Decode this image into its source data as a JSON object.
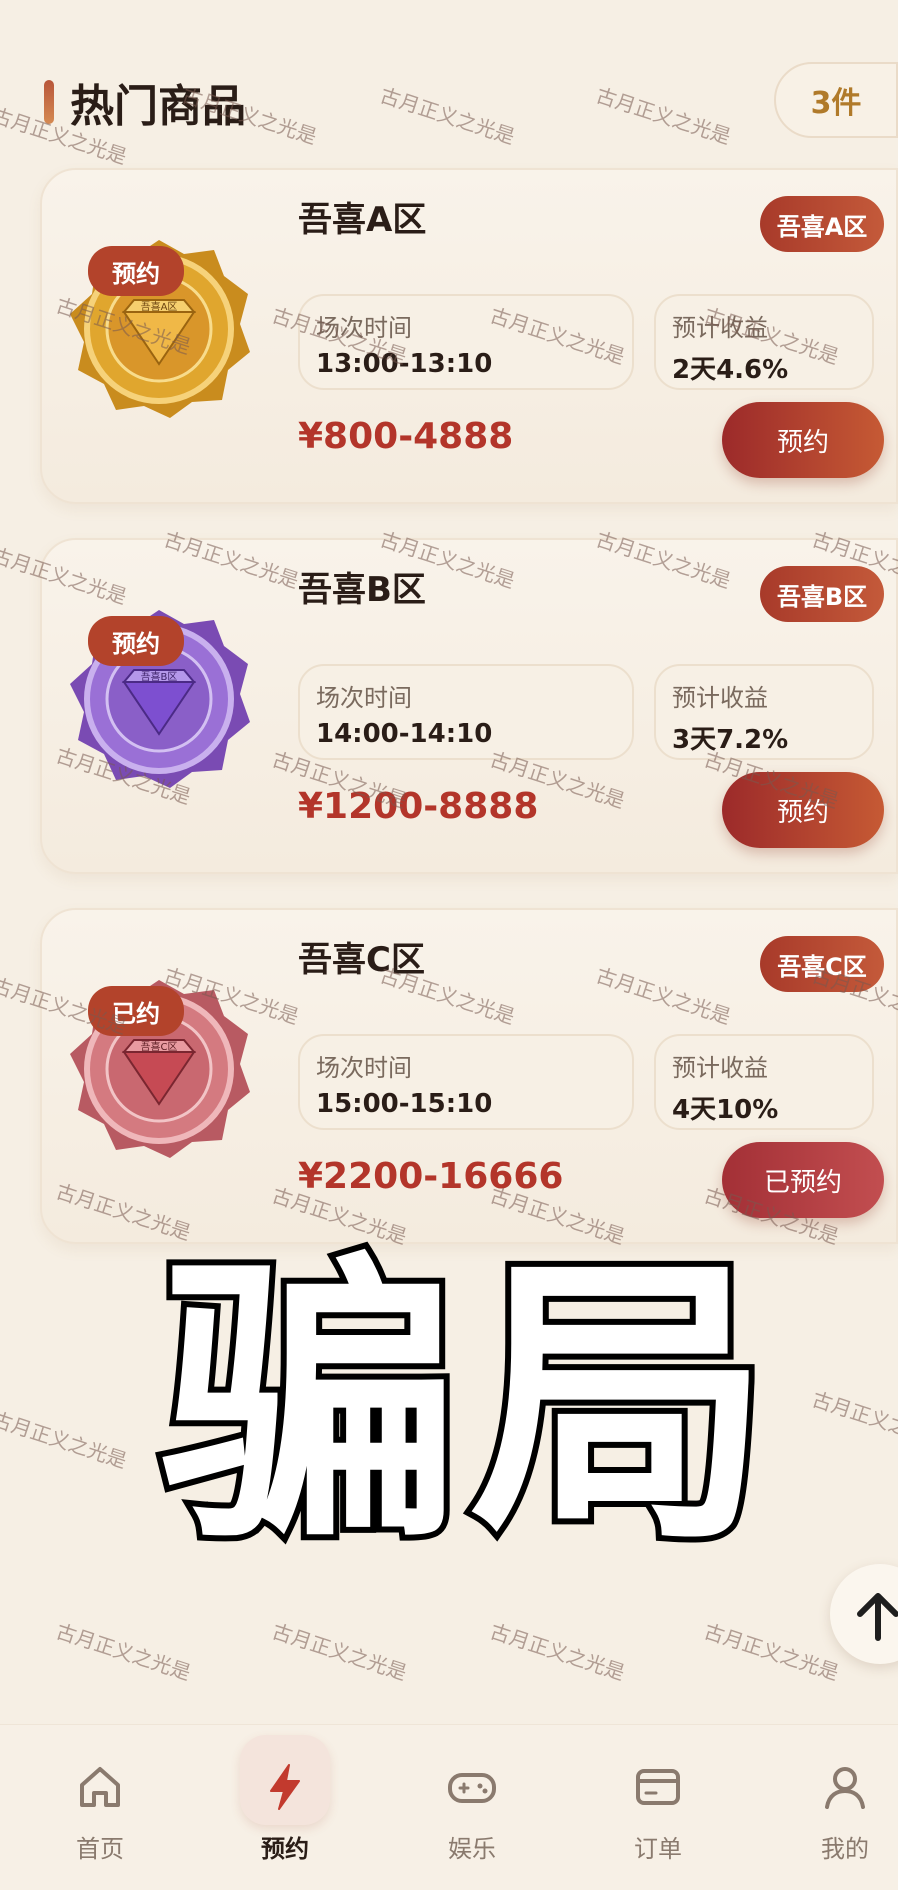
{
  "header": {
    "title": "热门商品",
    "count": "3件"
  },
  "products": [
    {
      "name": "吾喜A区",
      "tag": "预约",
      "zone": "吾喜A区",
      "time_label": "场次时间",
      "time_value": "13:00-13:10",
      "yield_label": "预计收益",
      "yield_value": "2天4.6%",
      "price": "¥800-4888",
      "action": "预约",
      "medal_text": "吾喜A区",
      "medal_color": "#e0a62e"
    },
    {
      "name": "吾喜B区",
      "tag": "预约",
      "zone": "吾喜B区",
      "time_label": "场次时间",
      "time_value": "14:00-14:10",
      "yield_label": "预计收益",
      "yield_value": "3天7.2%",
      "price": "¥1200-8888",
      "action": "预约",
      "medal_text": "吾喜B区",
      "medal_color": "#8e61c9"
    },
    {
      "name": "吾喜C区",
      "tag": "已约",
      "zone": "吾喜C区",
      "time_label": "场次时间",
      "time_value": "15:00-15:10",
      "yield_label": "预计收益",
      "yield_value": "4天10%",
      "price": "¥2200-16666",
      "action": "已预约",
      "medal_text": "吾喜C区",
      "medal_color": "#d47a80"
    }
  ],
  "overlay_text": "骗局",
  "watermark": "古月正义之光是",
  "nav": [
    {
      "label": "首页",
      "icon": "home-icon"
    },
    {
      "label": "预约",
      "icon": "lightning-icon",
      "active": true
    },
    {
      "label": "娱乐",
      "icon": "gamepad-icon"
    },
    {
      "label": "订单",
      "icon": "wallet-icon"
    },
    {
      "label": "我的",
      "icon": "user-icon"
    }
  ],
  "colors": {
    "accent": "#b3432b",
    "price": "#b3352a",
    "background": "#f6efe4"
  }
}
